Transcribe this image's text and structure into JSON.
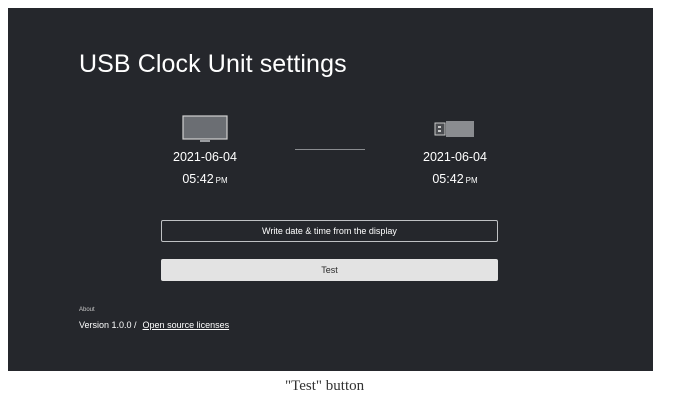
{
  "screen": {
    "title": "USB Clock Unit settings",
    "display": {
      "icon": "tv-icon",
      "date": "2021-06-04",
      "time": "05:42",
      "ampm": "PM"
    },
    "usb": {
      "icon": "usb-stick-icon",
      "date": "2021-06-04",
      "time": "05:42",
      "ampm": "PM"
    },
    "buttons": {
      "write_label": "Write date & time from the display",
      "test_label": "Test"
    },
    "about": {
      "label": "About",
      "version": "Version 1.0.0 /",
      "licenses_link": "Open source licenses"
    }
  },
  "caption": "\"Test\" button",
  "colors": {
    "screen_bg": "#25272c",
    "focused_button_bg": "#e3e3e3"
  }
}
